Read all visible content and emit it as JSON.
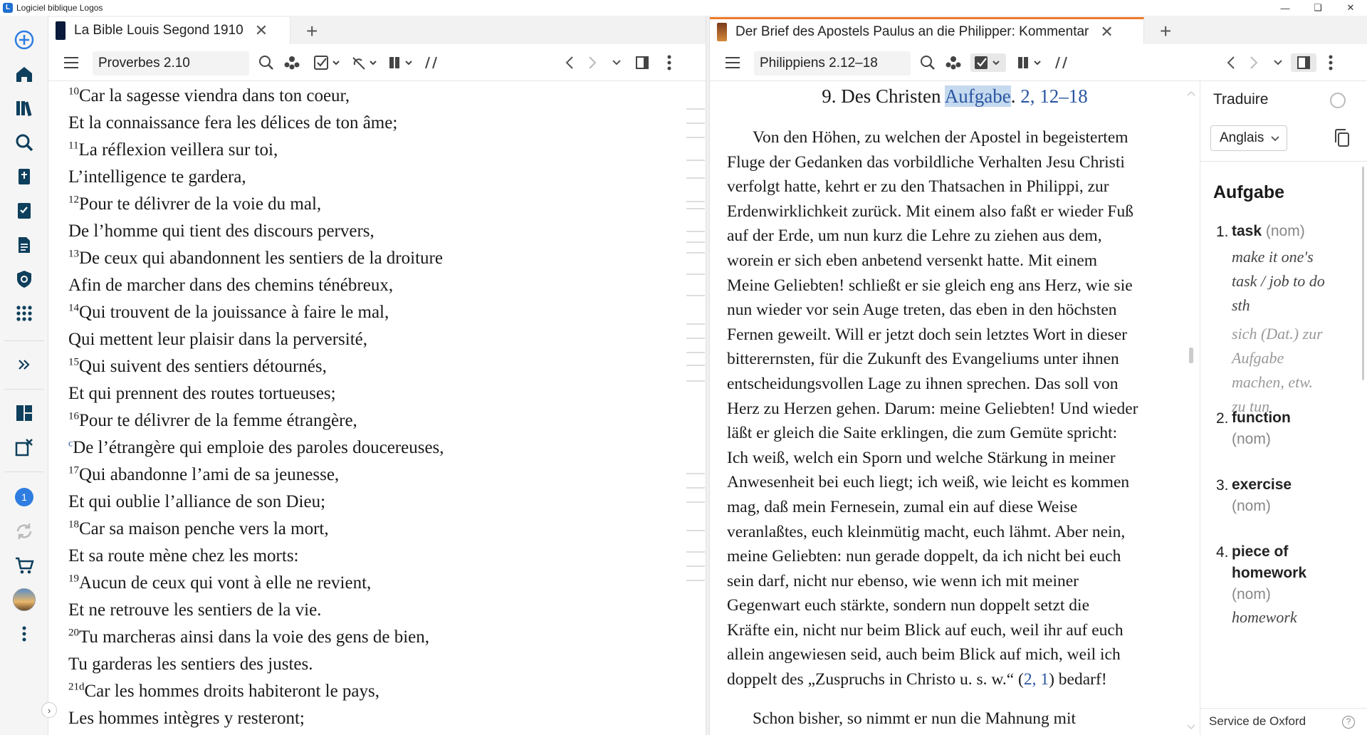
{
  "window": {
    "title": "Logiciel biblique Logos",
    "app_icon": "logos-app-icon"
  },
  "left_panel": {
    "tab_label": "La Bible Louis Segond 1910",
    "reference": "Proverbes 2.10",
    "verses": [
      {
        "num": "10",
        "text": "Car la sagesse viendra dans ton coeur,"
      },
      {
        "num": "",
        "text": "Et la connaissance fera les délices de ton âme;"
      },
      {
        "num": "11",
        "text": "La réflexion veillera sur toi,"
      },
      {
        "num": "",
        "text": "L’intelligence te gardera,"
      },
      {
        "num": "12",
        "text": "Pour te délivrer de la voie du mal,"
      },
      {
        "num": "",
        "text": "De l’homme qui tient des discours pervers,"
      },
      {
        "num": "13",
        "text": "De ceux qui abandonnent les sentiers de la droiture"
      },
      {
        "num": "",
        "text": "Afin de marcher dans des chemins ténébreux,"
      },
      {
        "num": "14",
        "text": "Qui trouvent de la jouissance à faire le mal,"
      },
      {
        "num": "",
        "text": "Qui mettent leur plaisir dans la perversité,"
      },
      {
        "num": "15",
        "text": "Qui suivent des sentiers détournés,"
      },
      {
        "num": "",
        "text": "Et qui prennent des routes tortueuses;"
      },
      {
        "num": "16",
        "text": "Pour te délivrer de la femme étrangère,"
      },
      {
        "num": "c",
        "text": "De l’étrangère qui emploie des paroles doucereuses,"
      },
      {
        "num": "17",
        "text": "Qui abandonne l’ami de sa jeunesse,"
      },
      {
        "num": "",
        "text": "Et qui oublie l’alliance de son Dieu;"
      },
      {
        "num": "18",
        "text": "Car sa maison penche vers la mort,"
      },
      {
        "num": "",
        "text": "Et sa route mène chez les morts:"
      },
      {
        "num": "19",
        "text": "Aucun de ceux qui vont à elle ne revient,"
      },
      {
        "num": "",
        "text": "Et ne retrouve les sentiers de la vie."
      },
      {
        "num": "20",
        "text": "Tu marcheras ainsi dans la voie des gens de bien,"
      },
      {
        "num": "",
        "text": "Tu garderas les sentiers des justes."
      },
      {
        "num": "21d",
        "text": "Car les hommes droits habiteront le pays,"
      },
      {
        "num": "",
        "text": "Les hommes intègres y resteront;"
      }
    ]
  },
  "right_panel": {
    "tab_label": "Der Brief des Apostels Paulus an die Philipper: Kommentar",
    "reference": "Philippiens 2.12–18",
    "heading": {
      "prefix": "9. Des Christen ",
      "highlight": "Aufgabe",
      "dot": ".",
      "ref": "2, 12–18"
    },
    "lines": [
      "Von den Höhen, zu welchen der Apostel in begeistertem",
      "Fluge der Gedanken das vorbildliche Verhalten Jesu Christi",
      "verfolgt hatte, kehrt er zu den Thatsachen in Philippi, zur",
      "Erdenwirklichkeit zurück. Mit einem also faßt er wieder Fuß",
      "auf der Erde, um nun kurz die Lehre zu ziehen aus dem,",
      "worein er sich eben anbetend versenkt hatte. Mit einem",
      "Meine Geliebten! schließt er sie gleich eng ans Herz, wie sie",
      "nun wieder vor sein Auge treten, das eben in den höchsten",
      "Fernen geweilt. Will er jetzt doch sein letztes Wort in dieser",
      "bitterernsten, für die Zukunft des Evangeliums unter ihnen",
      "entscheidungsvollen Lage zu ihnen sprechen. Das soll von",
      "Herz zu Herzen gehen. Darum: meine Geliebten! Und wieder",
      "läßt er gleich die Saite erklingen, die zum Gemüte spricht:",
      "Ich weiß, welch ein Sporn und welche Stärkung in meiner",
      "Anwesenheit bei euch liegt; ich weiß, wie leicht es kommen",
      "mag, daß mein Fernesein, zumal ein auf diese Weise",
      "veranlaßtes, euch kleinmütig macht, euch lähmt. Aber nein,",
      "meine Geliebten: nun gerade doppelt, da ich nicht bei euch",
      "sein darf, nicht nur ebenso, wie wenn ich mit meiner",
      "Gegenwart euch stärkte, sondern nun doppelt setzt die",
      "Kräfte ein, nicht nur beim Blick auf euch, weil ihr auf euch",
      "allein angewiesen seid, auch beim Blick auf mich, weil ich"
    ],
    "last_line": {
      "pre": "doppelt des „Zuspruchs in Christo u. s. w.“ (",
      "ref": "2, 1",
      "post": ") bedarf!"
    },
    "next_para": "Schon bisher, so nimmt er nun die Mahnung mit"
  },
  "translate": {
    "title": "Traduire",
    "language": "Anglais",
    "word": "Aufgabe",
    "senses": [
      {
        "num": "1.",
        "term": "task",
        "pos": "(nom)"
      },
      {
        "num": "2.",
        "term": "function",
        "pos": "(nom)"
      },
      {
        "num": "3.",
        "term": "exercise",
        "pos": "(nom)"
      },
      {
        "num": "4.",
        "term": "piece of homework",
        "pos": "(nom)"
      }
    ],
    "examples": [
      "make it one's",
      "task / job to do",
      "sth",
      "sich (Dat.) zur",
      "Aufgabe",
      "machen, etw.",
      "zu tun",
      "homework"
    ],
    "footer": "Service de Oxford"
  },
  "sidebar": {
    "notification_count": "1"
  },
  "colors": {
    "accent": "#2f7de1",
    "tab_indicator": "#f07a2a",
    "link": "#2a55a0",
    "highlight": "#c5d9ef"
  }
}
